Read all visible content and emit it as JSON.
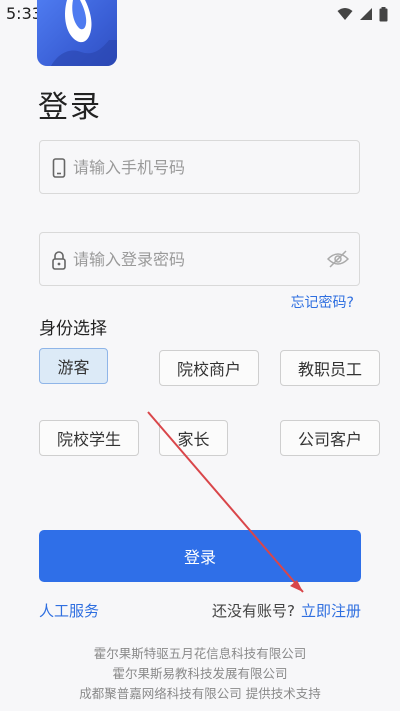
{
  "status_bar": {
    "time": "5:33",
    "icons": [
      "image-icon",
      "wifi-icon",
      "signal-icon",
      "battery-icon"
    ]
  },
  "app": {
    "logo": "app-logo"
  },
  "title": "登录",
  "phone": {
    "placeholder": "请输入手机号码",
    "icon": "phone-icon"
  },
  "password": {
    "placeholder": "请输入登录密码",
    "icon": "lock-icon",
    "toggle_icon": "eye-off-icon"
  },
  "forgot_password": "忘记密码?",
  "identity": {
    "label": "身份选择",
    "options": [
      "游客",
      "院校商户",
      "教职员工",
      "院校学生",
      "家长",
      "公司客户"
    ],
    "selected": "游客"
  },
  "login_button": "登录",
  "customer_service": "人工服务",
  "register": {
    "question": "还没有账号?",
    "link": "立即注册"
  },
  "footer": {
    "lines": [
      "霍尔果斯特驱五月花信息科技有限公司",
      "霍尔果斯易教科技发展有限公司",
      "成都聚普嘉网络科技有限公司 提供技术支持"
    ]
  },
  "colors": {
    "primary": "#2f6fe8",
    "link": "#2f6fe0",
    "selected_bg": "#dceaf7",
    "annotation_arrow": "#d9464a"
  }
}
